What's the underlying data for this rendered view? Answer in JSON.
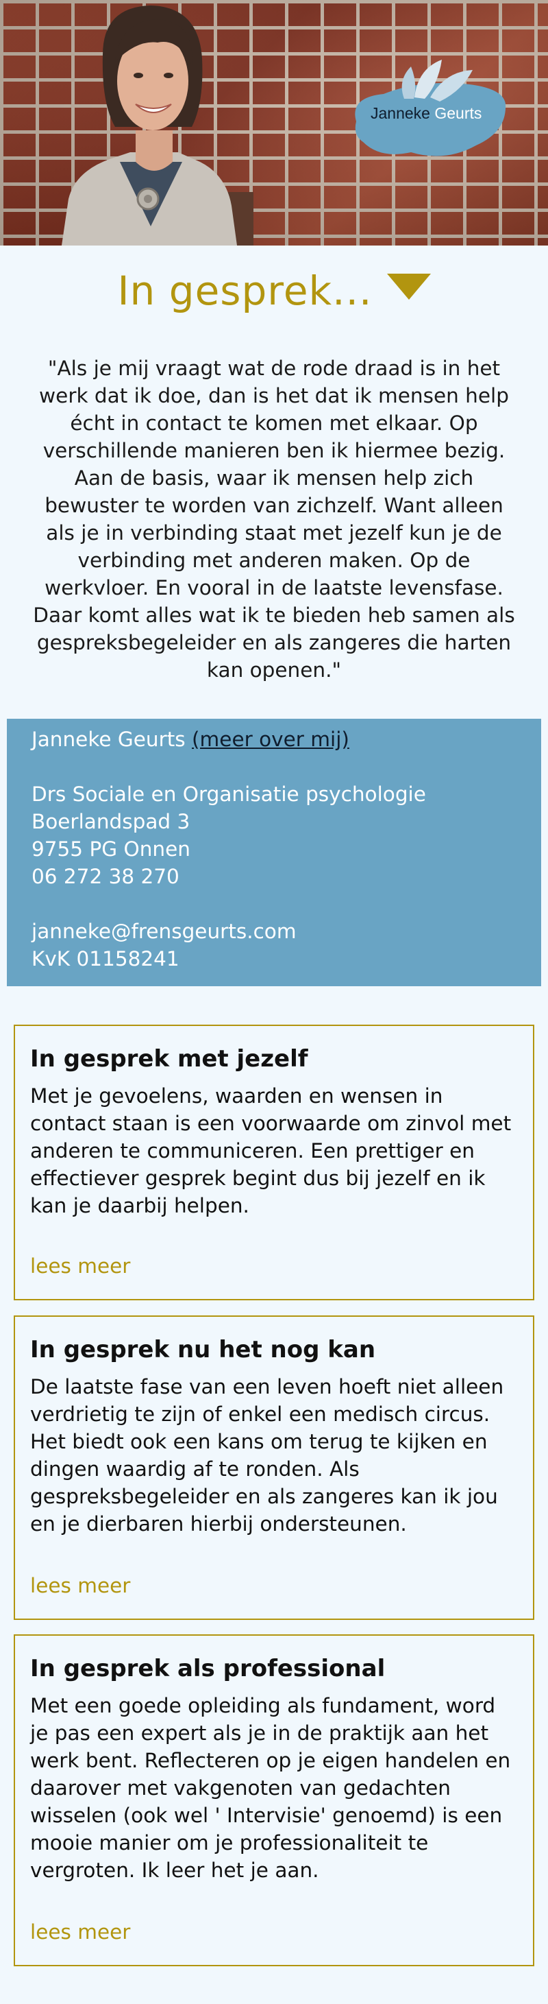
{
  "hero": {
    "logo": {
      "first": "Janneke",
      "last": "Geurts"
    }
  },
  "heading": {
    "title": "In gesprek...",
    "arrow_icon": "triangle-down-icon",
    "accent_color": "#b2950f"
  },
  "quote": {
    "lines": [
      "\"Als je mij vraagt wat de rode draad is in het",
      "werk dat ik doe, dan is het dat ik mensen help",
      "écht in contact te komen met elkaar. Op",
      "verschillende manieren ben ik hiermee bezig.",
      "Aan de basis, waar ik mensen help zich",
      "bewuster te worden van zichzelf. Want alleen",
      "als je in verbinding staat met jezelf kun je de",
      "verbinding met anderen maken. Op de",
      "werkvloer. En vooral in de laatste levensfase.",
      "Daar komt alles wat ik te bieden heb samen als",
      "gespreksbegeleider en als zangeres die harten",
      "kan openen.\""
    ]
  },
  "contact": {
    "name": "Janneke Geurts",
    "more_link": "(meer over mij)",
    "title": "Drs Sociale en Organisatie psychologie",
    "street": "Boerlandspad 3",
    "city": "9755 PG Onnen",
    "phone": "06 272 38 270",
    "email": "janneke@frensgeurts.com",
    "kvk": "KvK 01158241",
    "background_color": "#69a4c4"
  },
  "cards": [
    {
      "title": "In gesprek met jezelf",
      "lines": [
        "Met je gevoelens, waarden en wensen in",
        "contact staan is een voorwaarde om zinvol met",
        "anderen te communiceren. Een prettiger en",
        "effectiever gesprek begint dus bij jezelf en ik",
        "kan je daarbij helpen."
      ],
      "link": "lees meer"
    },
    {
      "title": "In gesprek nu het nog kan",
      "lines": [
        "De laatste fase van een leven hoeft niet alleen",
        "verdrietig te zijn of enkel een medisch circus.",
        "Het biedt ook een kans om terug te kijken en",
        "dingen waardig af te ronden. Als",
        "gespreksbegeleider en als zangeres kan ik jou",
        "en je dierbaren hierbij ondersteunen."
      ],
      "link": "lees meer"
    },
    {
      "title": "In gesprek als professional",
      "lines": [
        "Met een goede opleiding als fundament, word",
        "je pas een expert als je in de praktijk aan het",
        "werk bent. Reflecteren op je eigen handelen en",
        "daarover met vakgenoten van gedachten",
        "wisselen (ook wel ' Intervisie'  genoemd) is een",
        "mooie manier om je professionaliteit te",
        "vergroten. Ik leer het je aan."
      ],
      "link": "lees meer"
    }
  ]
}
